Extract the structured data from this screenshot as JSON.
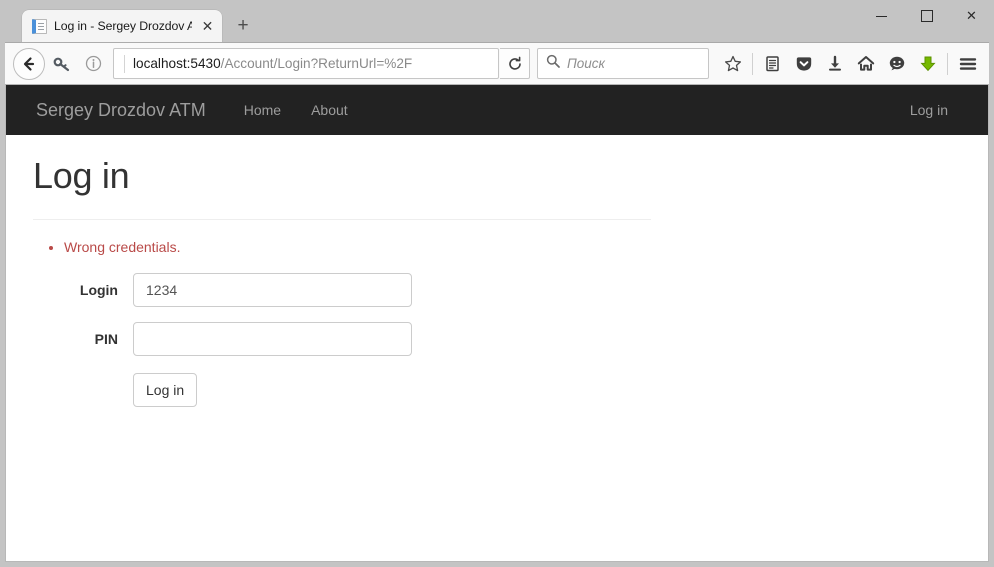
{
  "browser": {
    "tab": {
      "title": "Log in - Sergey Drozdov A...",
      "favicon_icon": "page-icon",
      "close_label": "✕"
    },
    "newtab_label": "+",
    "window_controls": {
      "minimize": "–",
      "maximize": "□",
      "close": "✕"
    },
    "navigation": {
      "back_icon": "back-arrow-icon",
      "forward_icon": "key-icon",
      "identity_icon": "info-circle-icon",
      "reload_icon": "reload-icon"
    },
    "url": {
      "domain": "localhost:5430",
      "path": "/Account/Login?ReturnUrl=%2F"
    },
    "search": {
      "placeholder": "Поиск",
      "icon": "search-icon"
    },
    "toolbar_icons": [
      "bookmark-star-icon",
      "reader-list-icon",
      "pocket-icon",
      "downloads-icon",
      "home-icon",
      "chat-icon",
      "downthemall-icon",
      "menu-hamburger-icon"
    ]
  },
  "page": {
    "navbar": {
      "brand": "Sergey Drozdov ATM",
      "links": [
        {
          "label": "Home"
        },
        {
          "label": "About"
        }
      ],
      "right_links": [
        {
          "label": "Log in"
        }
      ]
    },
    "title": "Log in",
    "validation": {
      "errors": [
        "Wrong credentials."
      ],
      "color": "#b94a48"
    },
    "form": {
      "fields": [
        {
          "label": "Login",
          "value": "1234",
          "placeholder": "",
          "type": "text"
        },
        {
          "label": "PIN",
          "value": "",
          "placeholder": "",
          "type": "password"
        }
      ],
      "submit_label": "Log in"
    }
  },
  "colors": {
    "navbar_bg": "#222222",
    "navbar_text": "#9d9d9d",
    "error_red": "#b94a48",
    "chrome_bg": "#c4c4c4"
  }
}
